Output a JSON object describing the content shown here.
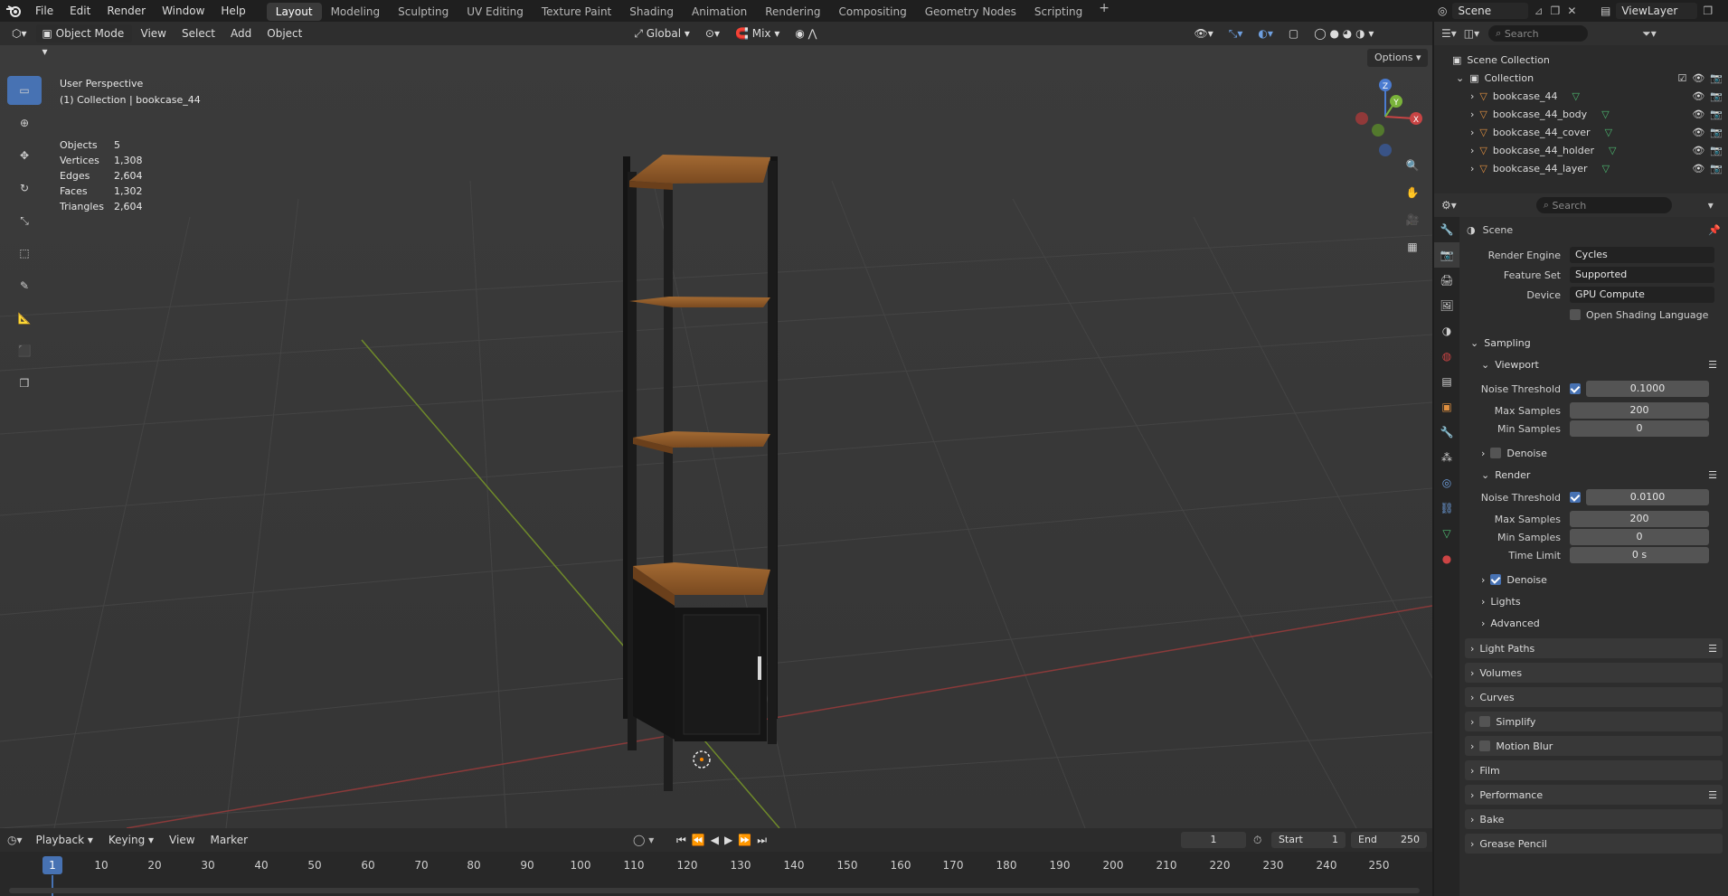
{
  "topbar": {
    "menus": [
      "File",
      "Edit",
      "Render",
      "Window",
      "Help"
    ],
    "workspaces": [
      "Layout",
      "Modeling",
      "Sculpting",
      "UV Editing",
      "Texture Paint",
      "Shading",
      "Animation",
      "Rendering",
      "Compositing",
      "Geometry Nodes",
      "Scripting"
    ],
    "active_workspace": "Layout",
    "add_tab": "+",
    "scene": "Scene",
    "view_layer": "ViewLayer"
  },
  "viewport": {
    "mode": "Object Mode",
    "menus": [
      "View",
      "Select",
      "Add",
      "Object"
    ],
    "orientation": "Global",
    "snap_mix": "Mix",
    "options_label": "Options",
    "perspective": "User Perspective",
    "collection_line": "(1) Collection | bookcase_44",
    "stats": [
      {
        "label": "Objects",
        "value": "5"
      },
      {
        "label": "Vertices",
        "value": "1,308"
      },
      {
        "label": "Edges",
        "value": "2,604"
      },
      {
        "label": "Faces",
        "value": "1,302"
      },
      {
        "label": "Triangles",
        "value": "2,604"
      }
    ],
    "gizmo_axes": {
      "x": "X",
      "y": "Y",
      "z": "Z"
    },
    "colors": {
      "bg": "#3a3a3a",
      "grid": "#454545",
      "x_axis": "#8a3a3a",
      "y_axis": "#6f8a2a",
      "wood": "#8a5a2b",
      "metal": "#1a1a1a"
    }
  },
  "outliner": {
    "search_placeholder": "Search",
    "root": "Scene Collection",
    "collection": "Collection",
    "items": [
      "bookcase_44",
      "bookcase_44_body",
      "bookcase_44_cover",
      "bookcase_44_holder",
      "bookcase_44_layer"
    ]
  },
  "properties": {
    "search_placeholder": "Search",
    "context": "Scene",
    "render_engine": {
      "label": "Render Engine",
      "value": "Cycles"
    },
    "feature_set": {
      "label": "Feature Set",
      "value": "Supported"
    },
    "device": {
      "label": "Device",
      "value": "GPU Compute"
    },
    "osl": "Open Shading Language",
    "sampling": "Sampling",
    "viewport": {
      "title": "Viewport",
      "noise_threshold_label": "Noise Threshold",
      "noise_threshold": "0.1000",
      "max_samples_label": "Max Samples",
      "max_samples": "200",
      "min_samples_label": "Min Samples",
      "min_samples": "0",
      "denoise": "Denoise"
    },
    "render": {
      "title": "Render",
      "noise_threshold_label": "Noise Threshold",
      "noise_threshold": "0.0100",
      "max_samples_label": "Max Samples",
      "max_samples": "200",
      "min_samples_label": "Min Samples",
      "min_samples": "0",
      "time_limit_label": "Time Limit",
      "time_limit": "0 s",
      "denoise": "Denoise"
    },
    "sub_sections": [
      "Lights",
      "Advanced"
    ],
    "panels": [
      "Light Paths",
      "Volumes",
      "Curves",
      "Simplify",
      "Motion Blur",
      "Film",
      "Performance",
      "Bake",
      "Grease Pencil"
    ]
  },
  "timeline": {
    "menus": [
      "Playback",
      "Keying",
      "View",
      "Marker"
    ],
    "current_frame": "1",
    "start_label": "Start",
    "start": "1",
    "end_label": "End",
    "end": "250",
    "ruler": [
      "1",
      "10",
      "20",
      "30",
      "40",
      "50",
      "60",
      "70",
      "80",
      "90",
      "100",
      "110",
      "120",
      "130",
      "140",
      "150",
      "160",
      "170",
      "180",
      "190",
      "200",
      "210",
      "220",
      "230",
      "240",
      "250"
    ]
  }
}
